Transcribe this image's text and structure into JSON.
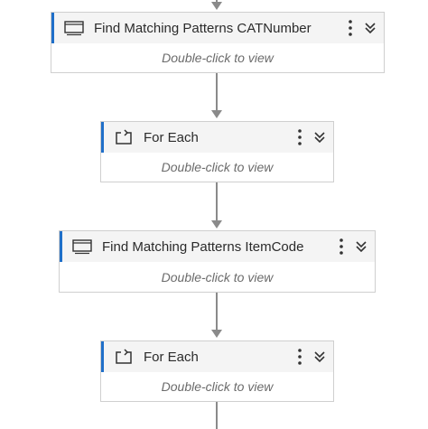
{
  "workflow": {
    "activities": [
      {
        "title": "Find Matching Patterns CATNumber",
        "body": "Double-click to view",
        "icon": "window-icon",
        "menu_icon": "more-vertical-icon",
        "collapse_icon": "chevron-double-down-icon"
      },
      {
        "title": "For Each",
        "body": "Double-click to view",
        "icon": "loop-icon",
        "menu_icon": "more-vertical-icon",
        "collapse_icon": "chevron-double-down-icon"
      },
      {
        "title": "Find Matching Patterns ItemCode",
        "body": "Double-click to view",
        "icon": "window-icon",
        "menu_icon": "more-vertical-icon",
        "collapse_icon": "chevron-double-down-icon"
      },
      {
        "title": "For Each",
        "body": "Double-click to view",
        "icon": "loop-icon",
        "menu_icon": "more-vertical-icon",
        "collapse_icon": "chevron-double-down-icon"
      }
    ]
  },
  "colors": {
    "accent": "#1f6fc9",
    "connector": "#8a8a8a",
    "header_bg": "#f4f4f4",
    "border": "#cfcfcf"
  }
}
